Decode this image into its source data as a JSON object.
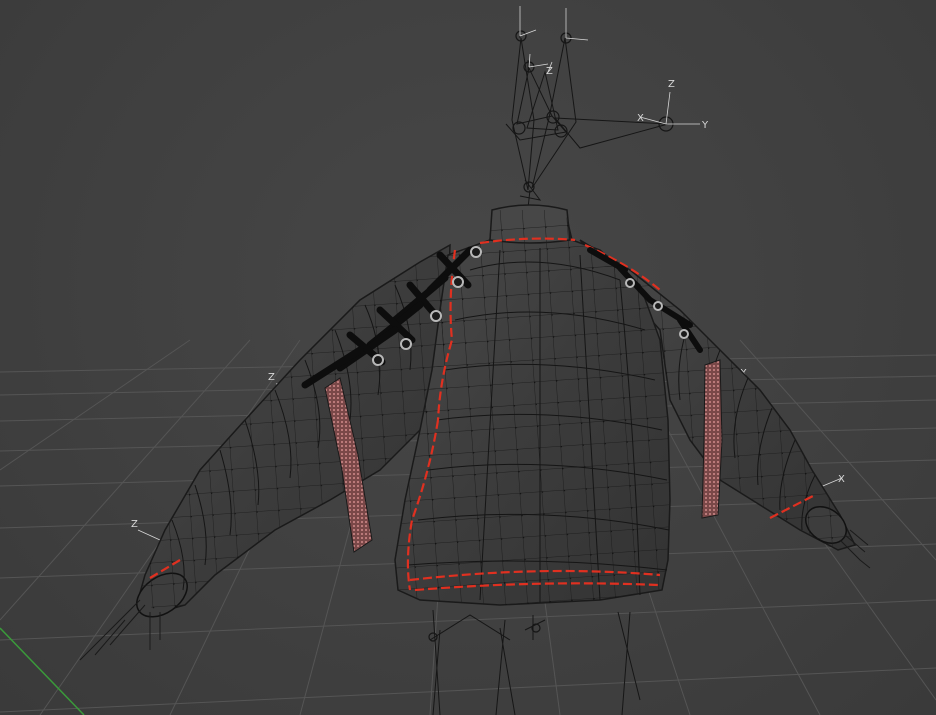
{
  "viewport": {
    "kind": "3d-viewport",
    "mesh": "sweater",
    "display": "wireframe-on-shaded",
    "seam_color": "#e03020",
    "grid_color": "#505050",
    "mesh_color": "#3a3a3a",
    "vertex_color": "#111111",
    "bone_color": "#161616",
    "y_axis_color": "#3a9a3a"
  },
  "axis_labels": {
    "x": "X",
    "y": "Y",
    "z": "Z"
  }
}
